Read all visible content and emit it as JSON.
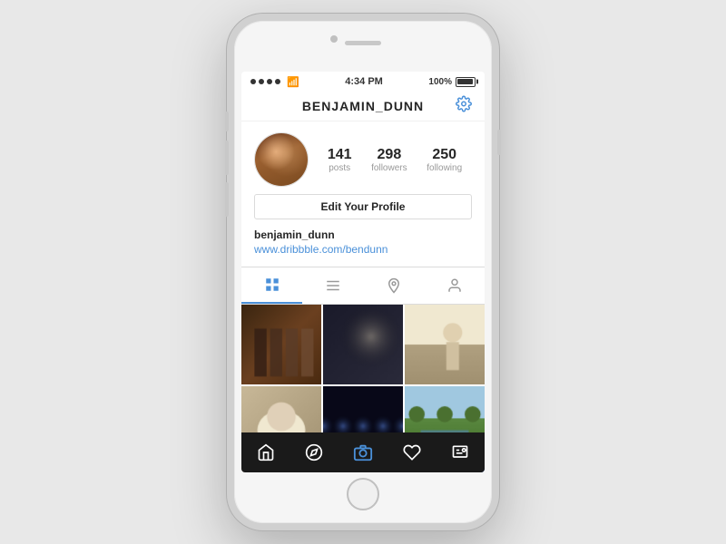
{
  "phone": {
    "status_bar": {
      "time": "4:34 PM",
      "battery_pct": "100%",
      "signal_dots": 4
    },
    "profile": {
      "username": "BENJAMIN_DUNN",
      "stats": {
        "posts": {
          "count": "141",
          "label": "posts"
        },
        "followers": {
          "count": "298",
          "label": "followers"
        },
        "following": {
          "count": "250",
          "label": "following"
        }
      },
      "edit_button_label": "Edit Your Profile",
      "bio_name": "benjamin_dunn",
      "bio_link": "www.dribbble.com/bendunn"
    },
    "tabs": [
      {
        "id": "grid",
        "label": "grid",
        "active": true
      },
      {
        "id": "list",
        "label": "list",
        "active": false
      },
      {
        "id": "location",
        "label": "location",
        "active": false
      },
      {
        "id": "person",
        "label": "person",
        "active": false
      }
    ],
    "photos": [
      {
        "id": 1,
        "colors": [
          "#4a3525",
          "#6b4e35",
          "#8a6a4a"
        ]
      },
      {
        "id": 2,
        "colors": [
          "#2a2a3a",
          "#4a5560",
          "#303545"
        ]
      },
      {
        "id": 3,
        "colors": [
          "#c8b090",
          "#a08060",
          "#d4c0a0"
        ]
      },
      {
        "id": 4,
        "colors": [
          "#8a7560",
          "#b09a80",
          "#6a5a48"
        ]
      },
      {
        "id": 5,
        "colors": [
          "#0a0a20",
          "#1a2a4a",
          "#0a1030"
        ]
      },
      {
        "id": 6,
        "colors": [
          "#4a7040",
          "#6a9060",
          "#3a5a30"
        ]
      },
      {
        "id": 7,
        "colors": [
          "#c8b0a0",
          "#e0cfc0",
          "#b09080"
        ]
      },
      {
        "id": 8,
        "colors": [
          "#808090",
          "#a0a0b0",
          "#606070"
        ]
      },
      {
        "id": 9,
        "colors": [
          "#2060c0",
          "#1a50a0",
          "#3070d0"
        ]
      }
    ],
    "bottom_nav": [
      {
        "id": "home",
        "label": "home"
      },
      {
        "id": "star",
        "label": "star/compass"
      },
      {
        "id": "camera",
        "label": "camera",
        "active": true
      },
      {
        "id": "heart",
        "label": "heart"
      },
      {
        "id": "news",
        "label": "news/profile"
      }
    ],
    "colors": {
      "accent": "#4a90d9",
      "text_primary": "#262626",
      "text_secondary": "#999999",
      "border": "#dbdbdb",
      "bottom_nav_bg": "#1a1a1a"
    }
  }
}
